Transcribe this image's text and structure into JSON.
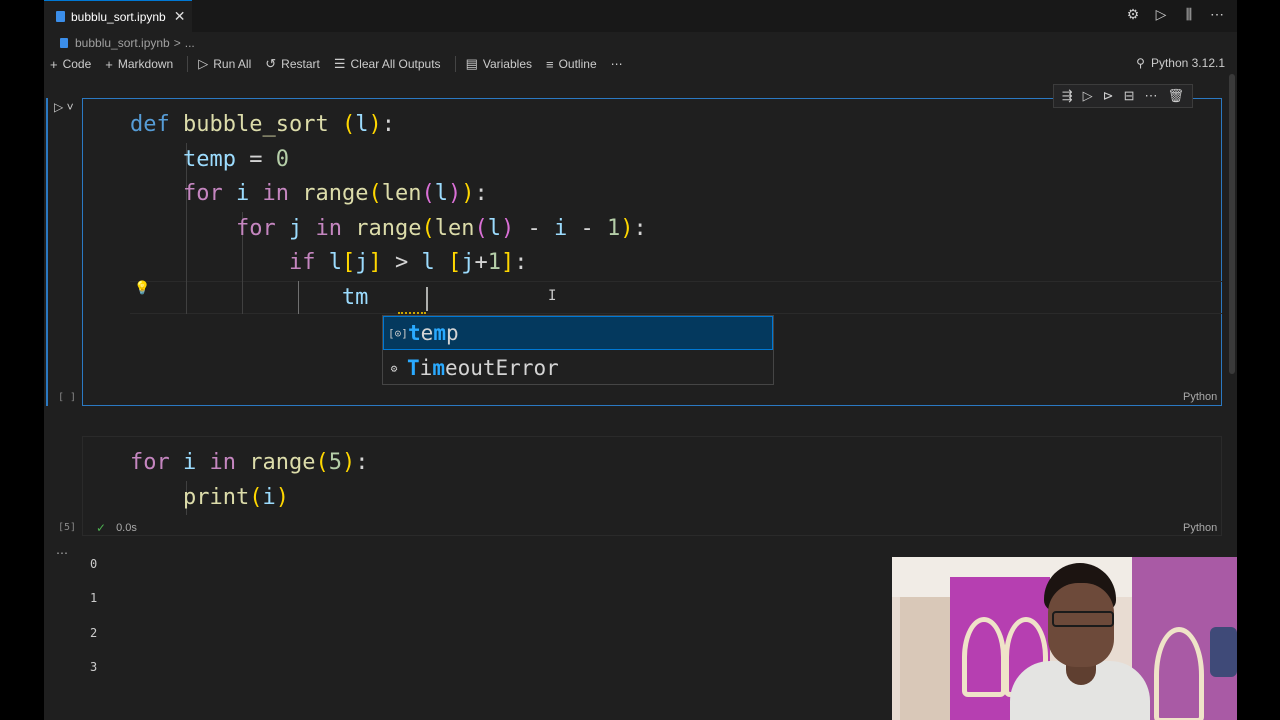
{
  "tab": {
    "title": "bubblu_sort.ipynb",
    "close": "✕"
  },
  "title_actions": [
    "⚙",
    "▷",
    "⫼",
    "⋯"
  ],
  "breadcrumb": {
    "file": "bubblu_sort.ipynb",
    "sep": ">",
    "more": "..."
  },
  "toolbar": {
    "code": "Code",
    "markdown": "Markdown",
    "run_all": "Run All",
    "restart": "Restart",
    "clear_outputs": "Clear All Outputs",
    "variables": "Variables",
    "outline": "Outline",
    "more": "⋯"
  },
  "kernel": "Python 3.12.1",
  "cell1": {
    "exec_count": "[ ]",
    "language": "Python",
    "typed": "tm"
  },
  "suggestions": [
    {
      "icon": "variable-icon",
      "label_match": "te",
      "label_rest": "mp",
      "label_full": "temp",
      "match_2": "m",
      "rest_2": "p"
    },
    {
      "icon": "class-icon",
      "label": "TimeoutError"
    }
  ],
  "cell2": {
    "exec_count": "[5]",
    "language": "Python",
    "duration": "0.0s"
  },
  "outputs": [
    "0",
    "1",
    "2",
    "3"
  ],
  "colors": {
    "accent": "#0078d4",
    "keyword": "#569cd6",
    "function": "#dcdcaa",
    "variable": "#9cdcfe"
  }
}
